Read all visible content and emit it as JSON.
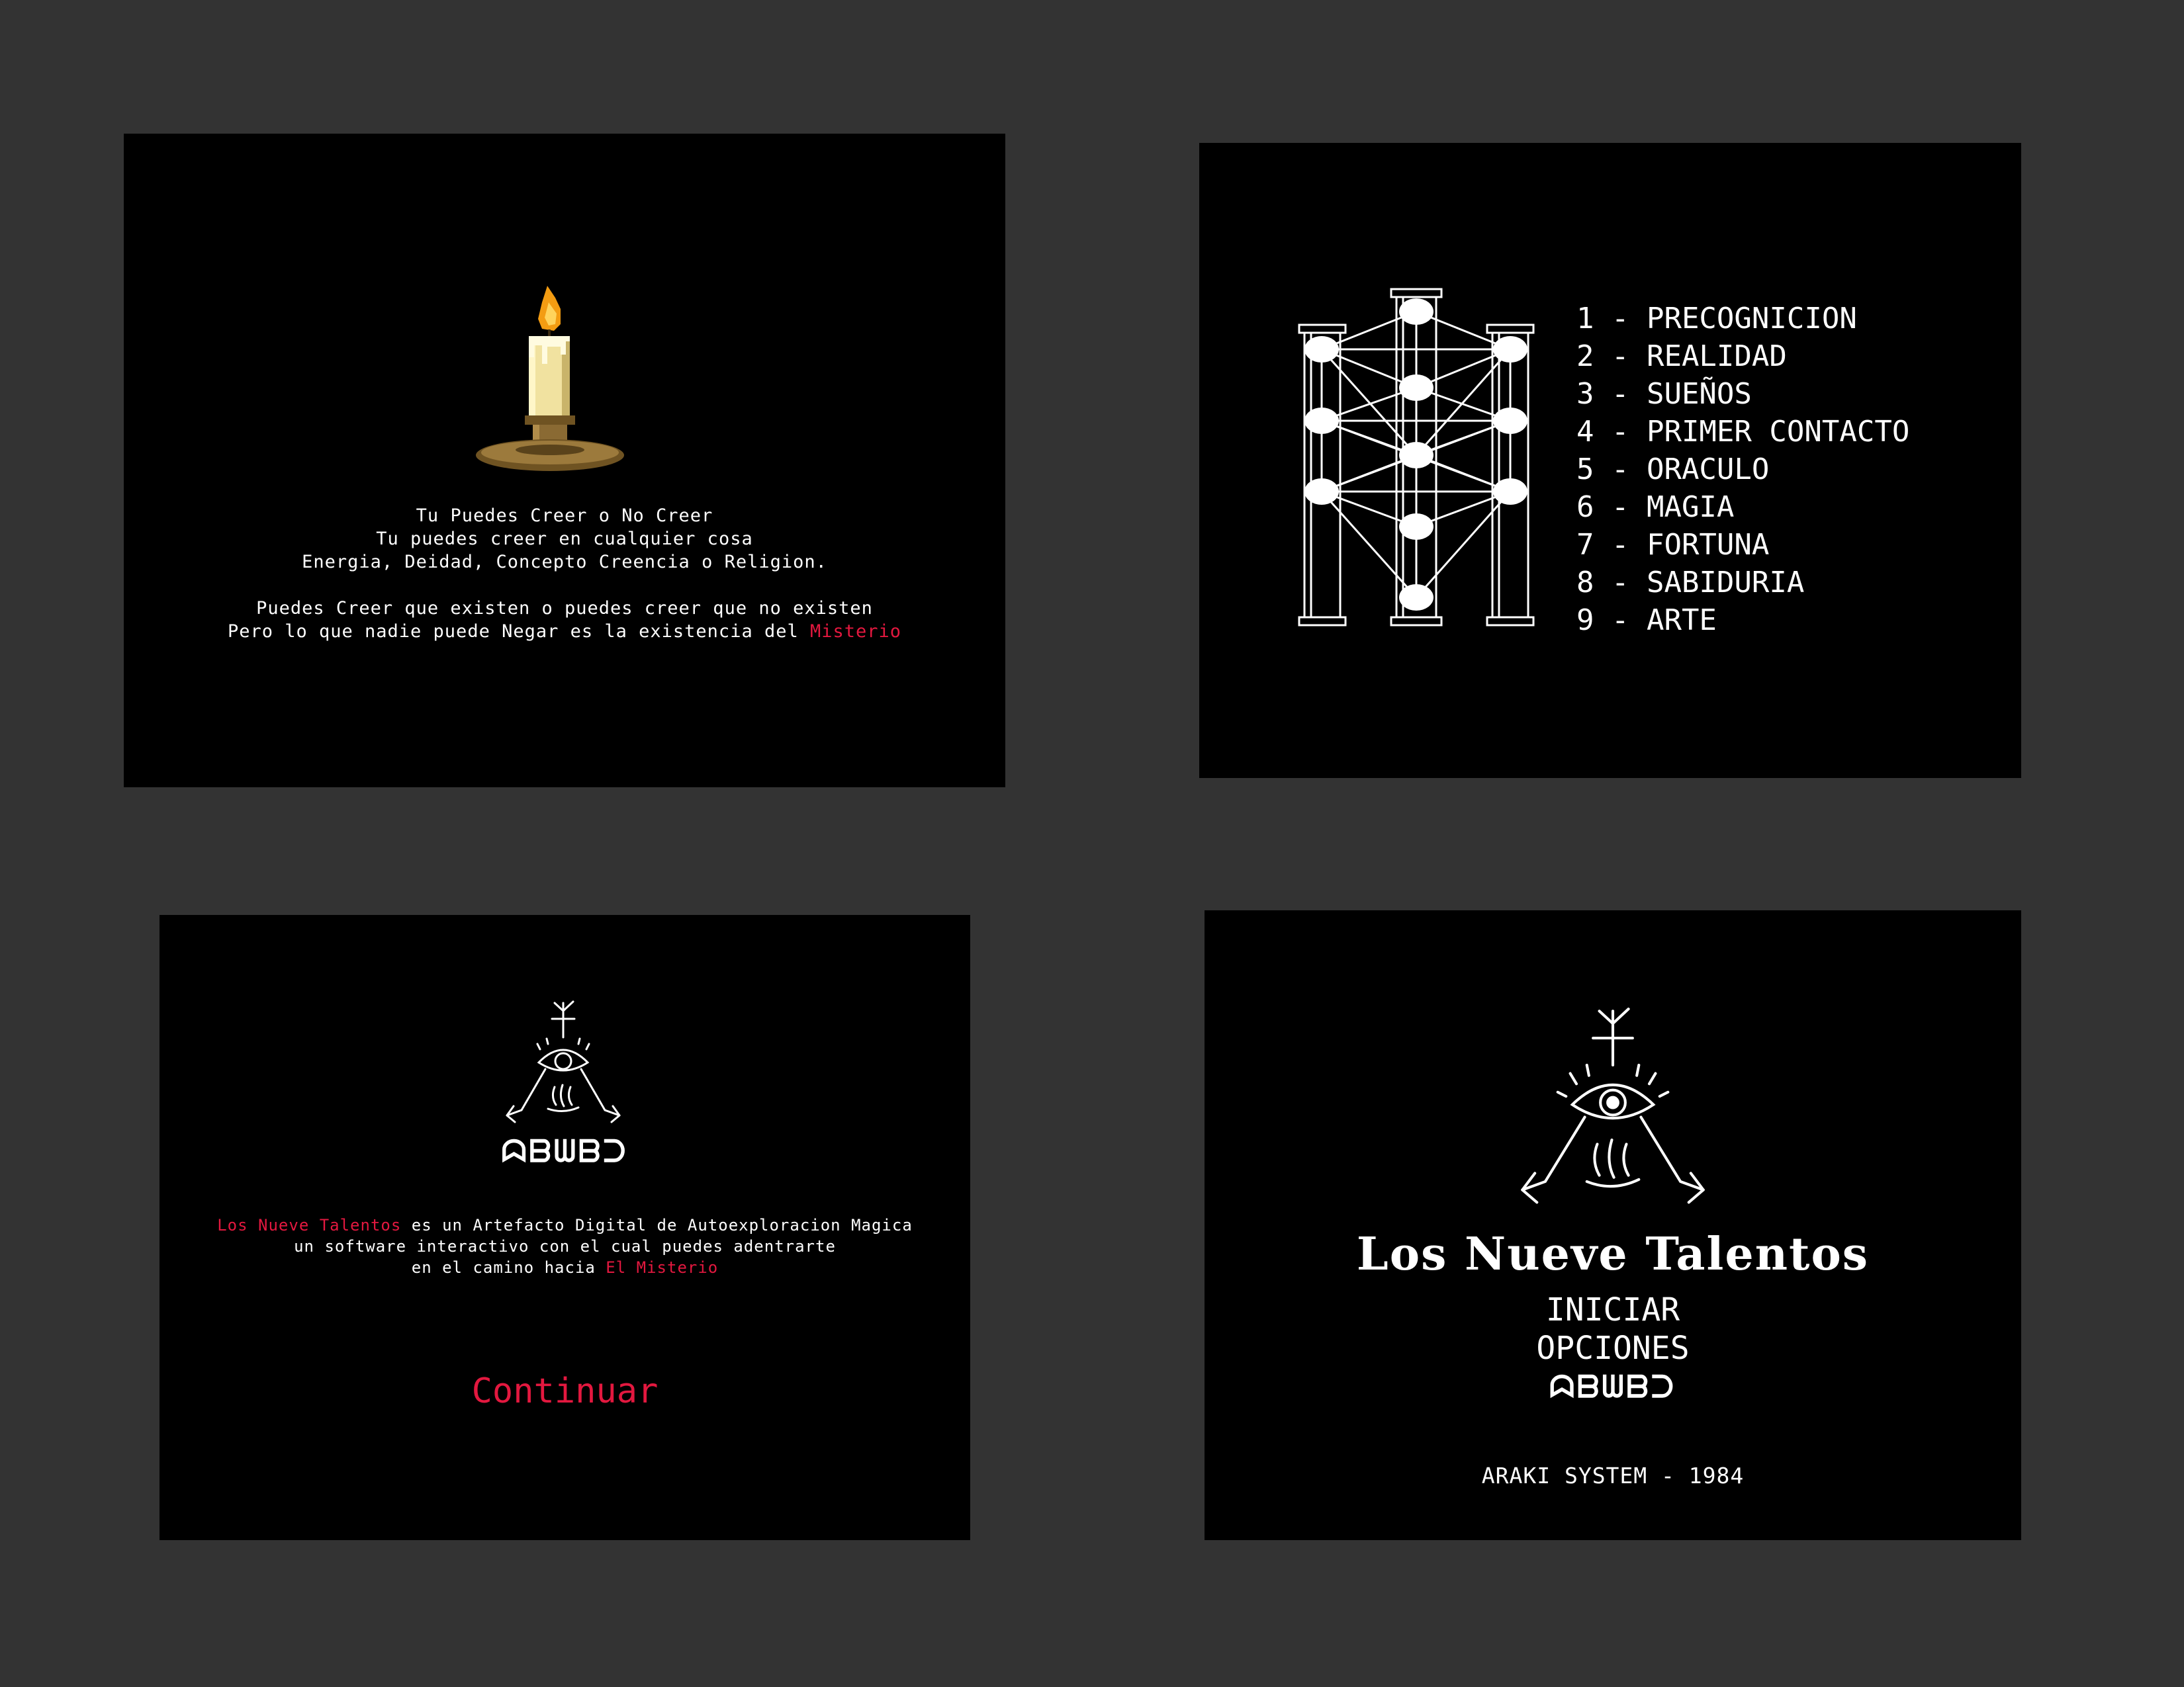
{
  "colors": {
    "background": "#333333",
    "screen": "#000000",
    "text": "#ffffff",
    "accent_red": "#e3183f",
    "candle_wax": "#f1e2a0",
    "candle_holder": "#8a6a33",
    "flame": "#f39c12"
  },
  "intro": {
    "icon": "candle-icon",
    "line1": "Tu Puedes Creer o No Creer",
    "line2": "Tu puedes creer en cualquier cosa",
    "line3": "Energia, Deidad, Concepto Creencia o Religion.",
    "line4": "Puedes Creer que existen o puedes creer que no existen",
    "line5_prefix": "Pero lo que nadie puede Negar es la existencia del ",
    "line5_highlight": "Misterio"
  },
  "talents_menu": {
    "icon": "tree-of-life-icon",
    "items": [
      "1 - PRECOGNICION",
      "2 - REALIDAD",
      "3 - SUEÑOS",
      "4 - PRIMER CONTACTO",
      "5 - ORACULO",
      "6 - MAGIA",
      "7 - FORTUNA",
      "8 - SABIDURIA",
      "9 - ARTE"
    ]
  },
  "continue_screen": {
    "icon": "eye-sigil-icon",
    "glyph_word": "ᗣᗷᗯᗷᑐ",
    "desc_highlight1": "Los Nueve Talentos",
    "desc_line1_rest": " es un Artefacto Digital de Autoexploracion Magica",
    "desc_line2": "un software interactivo con el cual puedes adentrarte",
    "desc_line3_prefix": "en el camino hacia ",
    "desc_highlight2": "El Misterio",
    "continue_label": "Continuar"
  },
  "title_screen": {
    "icon": "eye-sigil-icon",
    "title": "Los Nueve Talentos",
    "start_label": "INICIAR",
    "options_label": "OPCIONES",
    "glyph_word": "ᗣᗷᗯᗷᑐ",
    "credit": "ARAKI SYSTEM - 1984"
  }
}
